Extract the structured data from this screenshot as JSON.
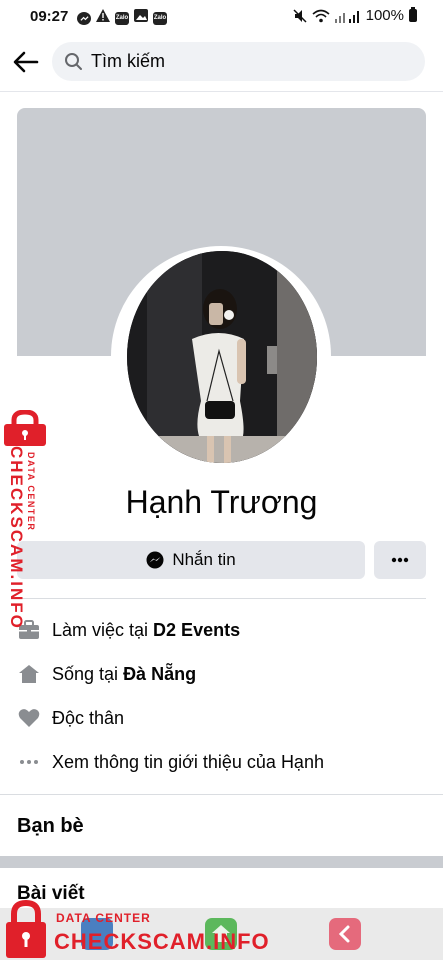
{
  "status_bar": {
    "time": "09:27",
    "app_icons": [
      "messenger-icon",
      "warning-icon",
      "zalo-icon",
      "gallery-icon",
      "zalo-icon"
    ],
    "app_icon_labels": [
      "",
      "",
      "Zalo",
      "",
      "Zalo"
    ],
    "battery": "100%"
  },
  "header": {
    "search_placeholder": "Tìm kiếm"
  },
  "profile": {
    "name": "Hạnh Trương",
    "message_button": "Nhắn tin",
    "more_button": "···"
  },
  "intro": {
    "work_prefix": "Làm việc tại ",
    "work_place": "D2 Events",
    "live_prefix": "Sống tại ",
    "live_place": "Đà Nẵng",
    "relationship": "Độc thân",
    "see_more": "Xem thông tin giới thiệu của Hạnh"
  },
  "sections": {
    "friends": "Bạn bè",
    "posts": "Bài viết"
  },
  "watermark": {
    "side_big": "CHECKSCAM.INFO",
    "side_small": "DATA CENTER",
    "bottom_big": "CHECKSCAM.INFO",
    "bottom_small": "DATA CENTER"
  },
  "colors": {
    "cover": "#c9ccd1",
    "button_bg": "#e4e6eb",
    "watermark_red": "#e0202a"
  }
}
